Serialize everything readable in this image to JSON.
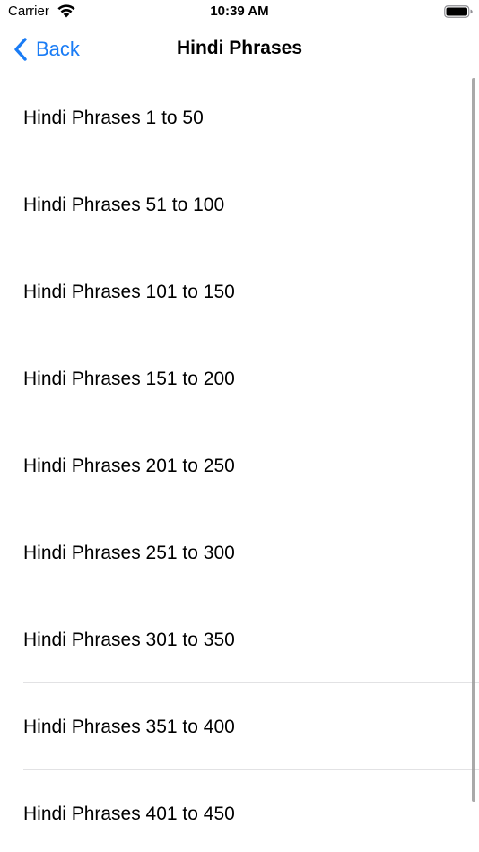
{
  "status_bar": {
    "carrier": "Carrier",
    "time": "10:39 AM",
    "wifi_icon": "wifi-icon",
    "battery_icon": "battery-icon"
  },
  "nav": {
    "back_label": "Back",
    "back_icon": "chevron-left-icon",
    "title": "Hindi Phrases",
    "accent_color": "#1a7cf5"
  },
  "list": {
    "items": [
      {
        "label": "Hindi Phrases 1 to 50"
      },
      {
        "label": "Hindi Phrases 51 to 100"
      },
      {
        "label": "Hindi Phrases 101 to 150"
      },
      {
        "label": "Hindi Phrases 151 to 200"
      },
      {
        "label": "Hindi Phrases 201 to 250"
      },
      {
        "label": "Hindi Phrases 251 to 300"
      },
      {
        "label": "Hindi Phrases 301 to 350"
      },
      {
        "label": "Hindi Phrases 351 to 400"
      },
      {
        "label": "Hindi Phrases 401 to 450"
      }
    ]
  }
}
